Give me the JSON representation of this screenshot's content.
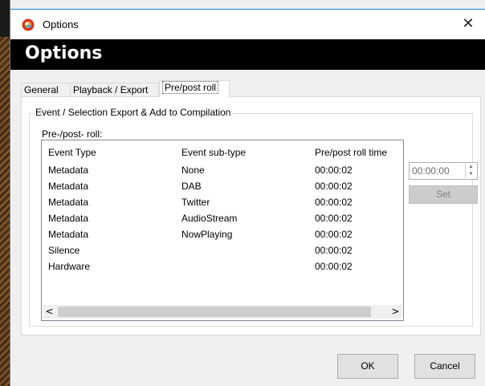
{
  "window": {
    "title": "Options",
    "heading": "Options",
    "close_glyph": "✕"
  },
  "tabs": [
    {
      "label": "General"
    },
    {
      "label": "Playback / Export"
    },
    {
      "label": "Pre/post roll",
      "selected": true
    }
  ],
  "group": {
    "legend": "Event / Selection Export & Add to Compilation",
    "list_label": "Pre-/post- roll:"
  },
  "table": {
    "columns": [
      "Event Type",
      "Event sub-type",
      "Pre/post roll time"
    ],
    "rows": [
      [
        "Metadata",
        "None",
        "00:00:02"
      ],
      [
        "Metadata",
        "DAB",
        "00:00:02"
      ],
      [
        "Metadata",
        "Twitter",
        "00:00:02"
      ],
      [
        "Metadata",
        "AudioStream",
        "00:00:02"
      ],
      [
        "Metadata",
        "NowPlaying",
        "00:00:02"
      ],
      [
        "Silence",
        "",
        "00:00:02"
      ],
      [
        "Hardware",
        "",
        "00:00:02"
      ]
    ],
    "scroll_left": "<",
    "scroll_right": ">"
  },
  "time_input": {
    "value": "00:00:00"
  },
  "set_button": {
    "label": "Set",
    "enabled": false
  },
  "footer": {
    "ok": "OK",
    "cancel": "Cancel"
  },
  "colors": {
    "header_bg": "#000000",
    "accent": "#1883d7"
  },
  "icons": {
    "app": "app-logo-icon",
    "close": "close-icon"
  }
}
